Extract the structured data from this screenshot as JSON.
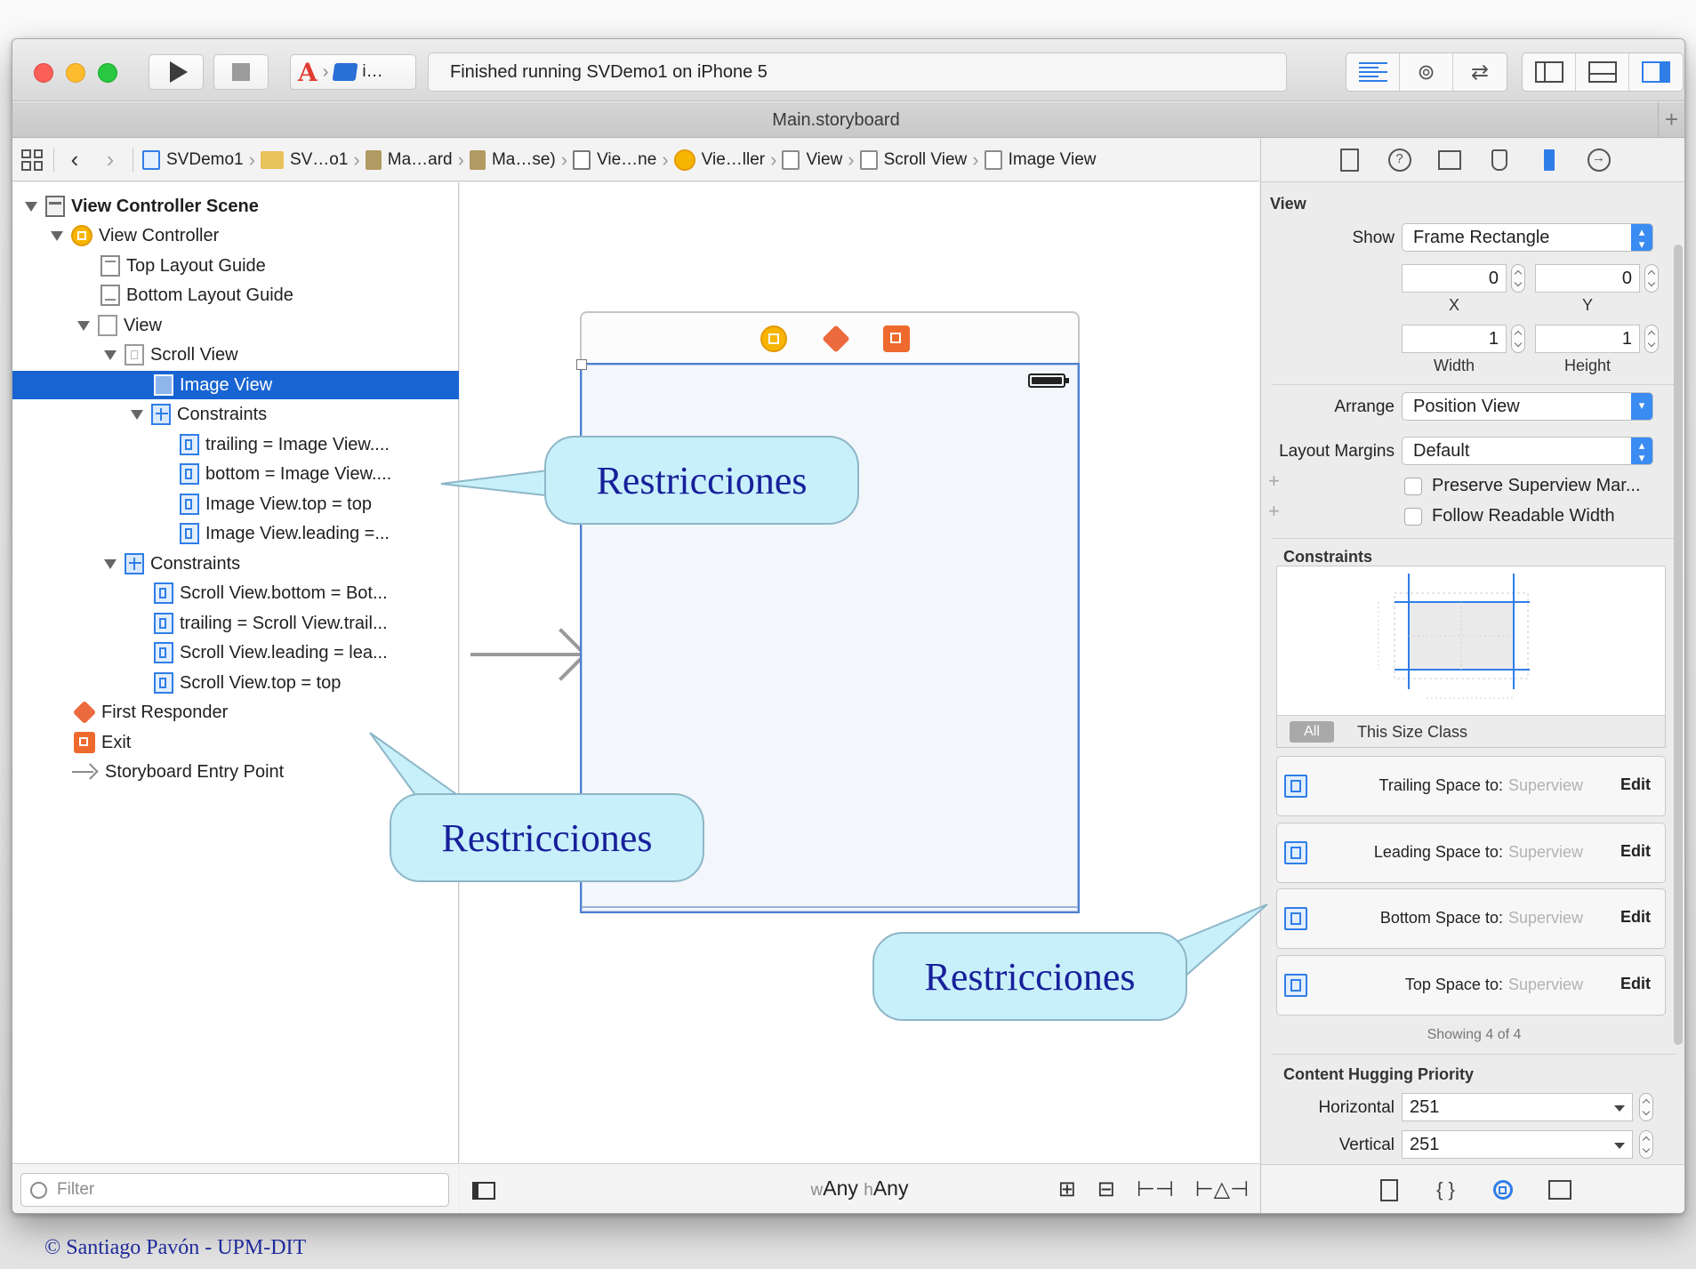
{
  "toolbar": {
    "scheme_label": "i…",
    "status_text": "Finished running SVDemo1 on iPhone 5"
  },
  "tabbar": {
    "title": "Main.storyboard",
    "plus": "+"
  },
  "jumpbar": {
    "crumbs": [
      "SVDemo1",
      "SV…o1",
      "Ma…ard",
      "Ma…se)",
      "Vie…ne",
      "Vie…ller",
      "View",
      "Scroll View",
      "Image View"
    ]
  },
  "outline": {
    "rows": [
      {
        "label": "View Controller Scene",
        "bold": true
      },
      {
        "label": "View Controller"
      },
      {
        "label": "Top Layout Guide"
      },
      {
        "label": "Bottom Layout Guide"
      },
      {
        "label": "View"
      },
      {
        "label": "Scroll View"
      },
      {
        "label": "Image View",
        "selected": true
      },
      {
        "label": "Constraints"
      },
      {
        "label": "trailing = Image View...."
      },
      {
        "label": "bottom = Image View...."
      },
      {
        "label": "Image View.top = top"
      },
      {
        "label": "Image View.leading =..."
      },
      {
        "label": "Constraints"
      },
      {
        "label": "Scroll View.bottom = Bot..."
      },
      {
        "label": "trailing = Scroll View.trail..."
      },
      {
        "label": "Scroll View.leading = lea..."
      },
      {
        "label": "Scroll View.top = top"
      },
      {
        "label": "First Responder"
      },
      {
        "label": "Exit"
      },
      {
        "label": "Storyboard Entry Point"
      }
    ],
    "filter_placeholder": "Filter"
  },
  "canvas": {
    "size_class": {
      "w_prefix": "w",
      "w_value": "Any",
      "h_prefix": "h",
      "h_value": "Any"
    },
    "bottom_icons": [
      "⊞",
      "⊟",
      "⊢⊣",
      "⊢△⊣"
    ]
  },
  "inspector": {
    "section_view": "View",
    "show_label": "Show",
    "show_value": "Frame Rectangle",
    "x_value": "0",
    "y_value": "0",
    "x_label": "X",
    "y_label": "Y",
    "width_value": "1",
    "height_value": "1",
    "width_label": "Width",
    "height_label": "Height",
    "arrange_label": "Arrange",
    "arrange_value": "Position View",
    "layout_margins_label": "Layout Margins",
    "layout_margins_value": "Default",
    "preserve_label": "Preserve Superview Mar...",
    "readable_label": "Follow Readable Width",
    "constraints_title": "Constraints",
    "filter_all": "All",
    "filter_size_class": "This Size Class",
    "constraint_items": [
      {
        "name": "Trailing Space to:",
        "target": "Superview",
        "action": "Edit"
      },
      {
        "name": "Leading Space to:",
        "target": "Superview",
        "action": "Edit"
      },
      {
        "name": "Bottom Space to:",
        "target": "Superview",
        "action": "Edit"
      },
      {
        "name": "Top Space to:",
        "target": "Superview",
        "action": "Edit"
      }
    ],
    "showing_text": "Showing 4 of 4",
    "hugging_title": "Content Hugging Priority",
    "horizontal_label": "Horizontal",
    "horizontal_value": "251",
    "vertical_label": "Vertical",
    "vertical_value": "251"
  },
  "callouts": {
    "outline_text": "Restricciones",
    "canvas_text": "Restricciones",
    "inspector_text": "Restricciones"
  },
  "footer": {
    "copyright": "© Santiago Pavón - UPM-DIT"
  }
}
